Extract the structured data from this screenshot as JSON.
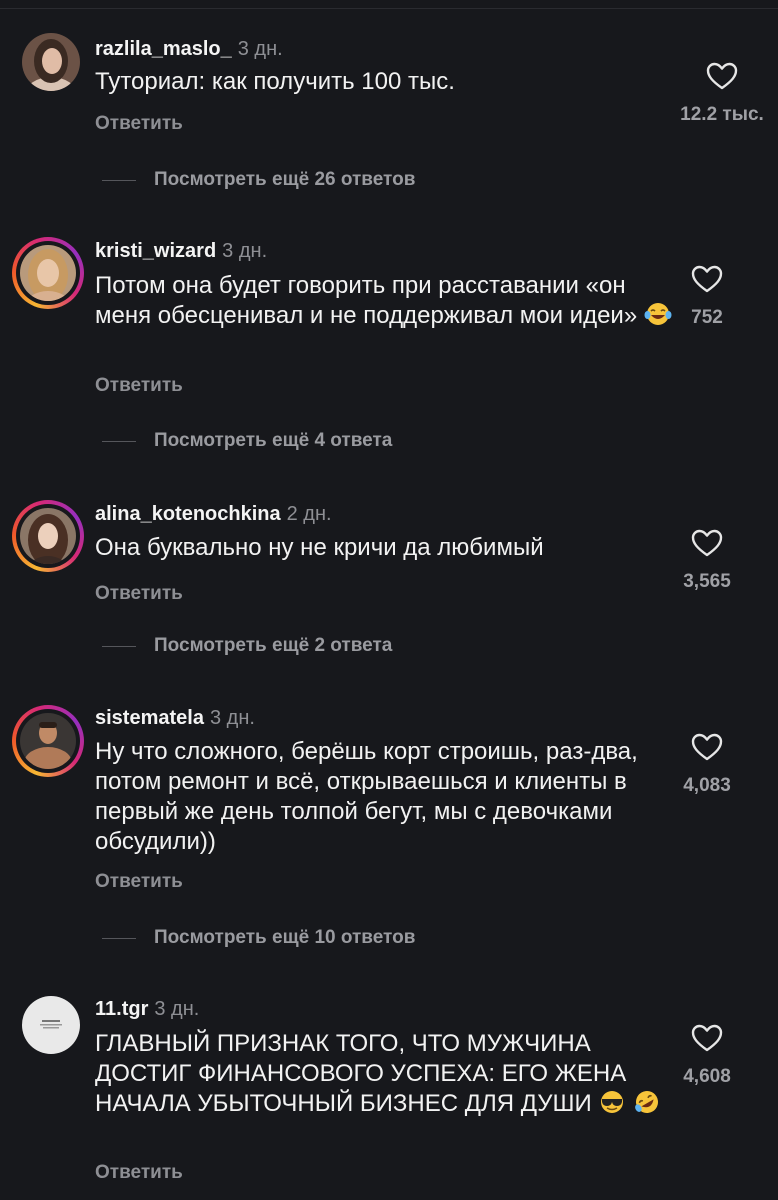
{
  "comments": [
    {
      "username": "razlila_maslo_",
      "time": "3 дн.",
      "text": "Туториал: как получить 100 тыс.",
      "emoji": [],
      "reply_label": "Ответить",
      "likes": "12.2 тыс.",
      "more_replies": "Посмотреть ещё 26 ответов"
    },
    {
      "username": "kristi_wizard",
      "time": "3 дн.",
      "text": "Потом она будет говорить при расставании «он меня обесценивал и не поддерживал мои идеи»",
      "emoji": [
        "laughing-tears-emoji"
      ],
      "reply_label": "Ответить",
      "likes": "752",
      "more_replies": "Посмотреть ещё 4 ответа"
    },
    {
      "username": "alina_kotenochkina",
      "time": "2 дн.",
      "text": "Она буквально ну не кричи да любимый",
      "emoji": [],
      "reply_label": "Ответить",
      "likes": "3,565",
      "more_replies": "Посмотреть ещё 2 ответа"
    },
    {
      "username": "sistematela",
      "time": "3 дн.",
      "text": "Ну что сложного, берёшь корт строишь, раз-два, потом ремонт и всё, открываешься и клиенты в первый же день толпой бегут, мы с девочками обсудили))",
      "emoji": [],
      "reply_label": "Ответить",
      "likes": "4,083",
      "more_replies": "Посмотреть ещё 10 ответов"
    },
    {
      "username": "11.tgr",
      "time": "3 дн.",
      "text": "ГЛАВНЫЙ ПРИЗНАК ТОГО, ЧТО МУЖЧИНА ДОСТИГ ФИНАНСОВОГО УСПЕХА: ЕГО ЖЕНА НАЧАЛА УБЫТОЧНЫЙ БИЗНЕС ДЛЯ ДУШИ",
      "emoji": [
        "sunglasses-emoji",
        "rolling-laughing-emoji"
      ],
      "reply_label": "Ответить",
      "likes": "4,608"
    }
  ],
  "colors": {
    "background": "#17181c",
    "secondary_text": "#8e8f94",
    "story_ring": "#d62976"
  }
}
